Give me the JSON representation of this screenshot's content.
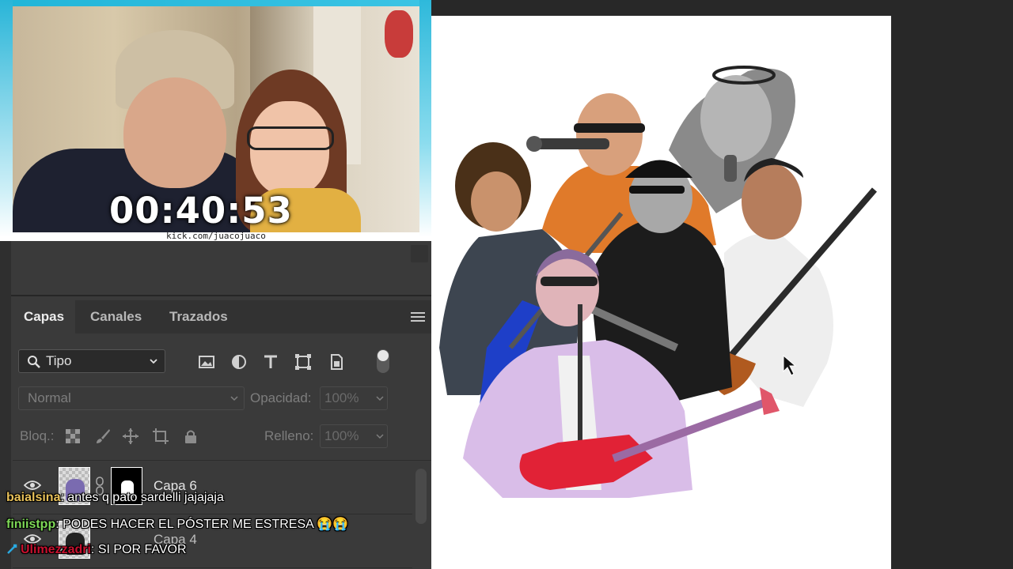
{
  "webcam": {
    "timer": "00:40:53",
    "channel": "kick.com/juacojuaco"
  },
  "layers_panel": {
    "tabs": [
      {
        "label": "Capas",
        "active": true
      },
      {
        "label": "Canales",
        "active": false
      },
      {
        "label": "Trazados",
        "active": false
      }
    ],
    "filter": {
      "label": "Tipo"
    },
    "blend_mode": "Normal",
    "opacity_label": "Opacidad:",
    "opacity_value": "100%",
    "lock_label": "Bloq.:",
    "fill_label": "Relleno:",
    "fill_value": "100%",
    "layers": [
      {
        "name": "Capa 6"
      },
      {
        "name": "Capa 4"
      }
    ]
  },
  "chat": [
    {
      "user": "baialsina",
      "user_color": "#e8c15a",
      "message": "antes q pato sardelli jajajaja"
    },
    {
      "user": "finiistpp",
      "user_color": "#7ed957",
      "message": "PODES HACER EL PÓSTER ME ESTRESA 😭😭"
    },
    {
      "user": "Ulimezzadri",
      "user_color": "#c8102e",
      "message": "SI POR FAVOR",
      "badge_color": "#2aa9e0"
    }
  ],
  "colors": {
    "accent_cyan": "#21b5d8",
    "panel_bg": "#3a3a3a",
    "workspace_bg": "#282828"
  }
}
